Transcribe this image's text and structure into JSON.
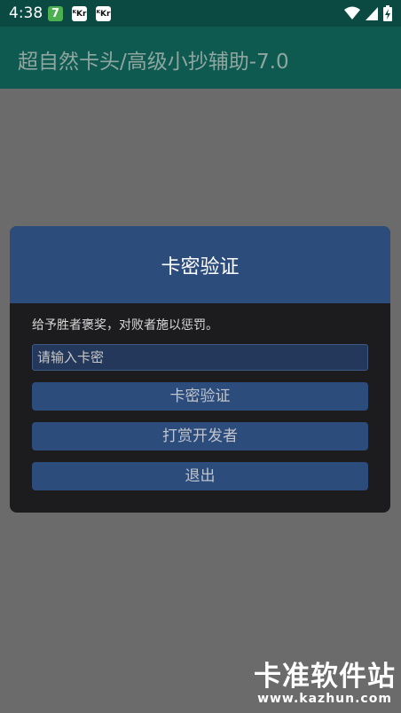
{
  "status_bar": {
    "time": "4:38",
    "notifications": [
      {
        "icon": "green-7-app-icon",
        "glyph": "7"
      },
      {
        "icon": "kr-app-icon",
        "glyph": "ᴷKr"
      },
      {
        "icon": "kr-app-icon",
        "glyph": "ᴷKr"
      }
    ],
    "icons": [
      "wifi-icon",
      "signal-icon",
      "battery-icon"
    ]
  },
  "app_bar": {
    "title": "超自然卡头/高级小抄辅助-7.0"
  },
  "dialog": {
    "title": "卡密验证",
    "message": "给予胜者褒奖，对败者施以惩罚。",
    "input_placeholder": "请输入卡密",
    "verify_button": "卡密验证",
    "tip_button": "打赏开发者",
    "exit_button": "退出"
  },
  "watermark": {
    "title": "卡准软件站",
    "url": "www.kazhun.com"
  },
  "colors": {
    "status_bar": "#0b4a42",
    "app_bar": "#0e5a51",
    "dialog_header": "#2c4c7c",
    "dialog_body": "#1c1c1e",
    "scrim": "#6b6b6b"
  }
}
